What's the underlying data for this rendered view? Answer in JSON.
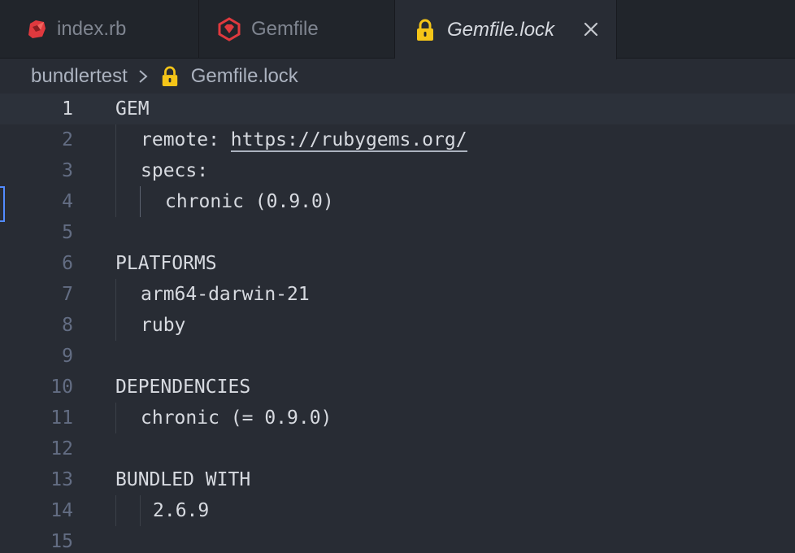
{
  "tabs": [
    {
      "label": "index.rb",
      "icon": "ruby-icon",
      "active": false
    },
    {
      "label": "Gemfile",
      "icon": "gem-icon",
      "active": false
    },
    {
      "label": "Gemfile.lock",
      "icon": "lock-icon",
      "active": true
    }
  ],
  "breadcrumb": {
    "folder": "bundlertest",
    "separator_icon": "chevron-right-icon",
    "file_icon": "lock-icon",
    "file": "Gemfile.lock"
  },
  "editor": {
    "current_line": 1,
    "lines": [
      {
        "n": "1",
        "text": "GEM"
      },
      {
        "n": "2",
        "text_prefix": "remote: ",
        "link": "https://rubygems.org/"
      },
      {
        "n": "3",
        "text": "specs:"
      },
      {
        "n": "4",
        "text": "chronic (0.9.0)"
      },
      {
        "n": "5",
        "text": ""
      },
      {
        "n": "6",
        "text": "PLATFORMS"
      },
      {
        "n": "7",
        "text": "arm64-darwin-21"
      },
      {
        "n": "8",
        "text": "ruby"
      },
      {
        "n": "9",
        "text": ""
      },
      {
        "n": "10",
        "text": "DEPENDENCIES"
      },
      {
        "n": "11",
        "text": "chronic (= 0.9.0)"
      },
      {
        "n": "12",
        "text": ""
      },
      {
        "n": "13",
        "text": "BUNDLED WITH"
      },
      {
        "n": "14",
        "text": "2.6.9"
      },
      {
        "n": "15",
        "text": ""
      }
    ]
  },
  "colors": {
    "background": "#282c34",
    "tabbar": "#21252b",
    "text": "#d7dae0",
    "line_number": "#636d83",
    "ruby_red": "#e0393e",
    "lock_yellow": "#f5c518"
  }
}
